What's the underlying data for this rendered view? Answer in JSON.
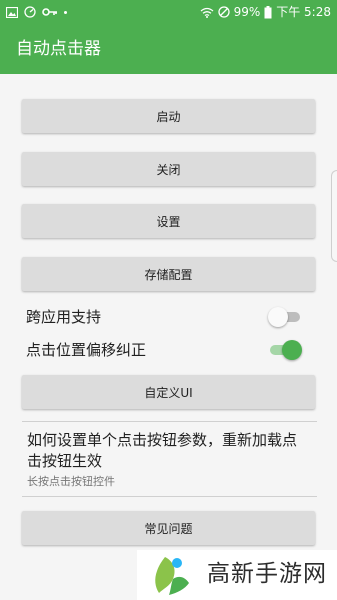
{
  "status_bar": {
    "battery": "99%",
    "time": "下午 5:28",
    "icons": [
      "image-icon",
      "speedometer-icon",
      "key-icon",
      "wifi-icon",
      "dnd-icon",
      "battery-icon"
    ]
  },
  "app_bar": {
    "title": "自动点击器"
  },
  "buttons": {
    "start": "启动",
    "close": "关闭",
    "settings": "设置",
    "save_config": "存储配置",
    "custom_ui": "自定义UI",
    "faq": "常见问题"
  },
  "toggles": [
    {
      "label": "跨应用支持",
      "on": false
    },
    {
      "label": "点击位置偏移纠正",
      "on": true
    }
  ],
  "help": {
    "title": "如何设置单个点击按钮参数，重新加载点击按钮生效",
    "subtitle": "长按点击按钮控件"
  },
  "watermark": {
    "text": "高新手游网"
  },
  "colors": {
    "primary": "#4caf50",
    "button_bg": "#dcdcdc",
    "background": "#f5f5f5"
  }
}
